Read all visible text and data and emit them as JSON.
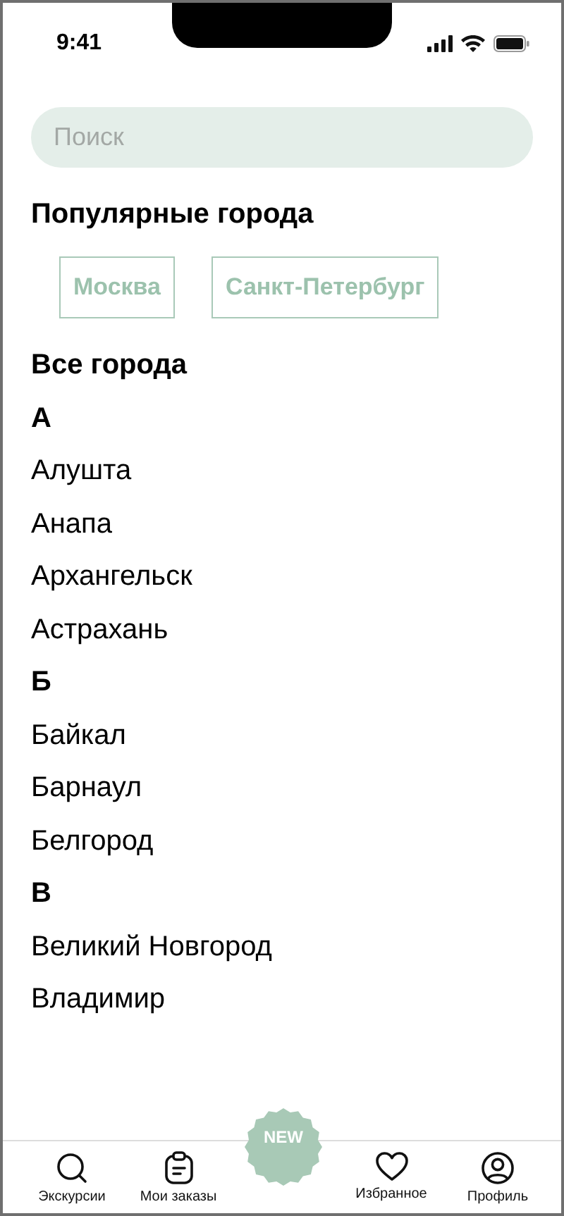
{
  "status_bar": {
    "time": "9:41"
  },
  "search": {
    "placeholder": "Поиск"
  },
  "popular": {
    "title": "Популярные города",
    "cities": [
      "Москва",
      "Санкт-Петербург"
    ]
  },
  "all": {
    "title": "Все города",
    "groups": [
      {
        "letter": "А",
        "cities": [
          "Алушта",
          "Анапа",
          "Архангельск",
          "Астрахань"
        ]
      },
      {
        "letter": "Б",
        "cities": [
          "Байкал",
          "Барнаул",
          "Белгород"
        ]
      },
      {
        "letter": "В",
        "cities": [
          "Великий Новгород",
          "Владимир"
        ]
      }
    ]
  },
  "tab_bar": {
    "items": [
      {
        "label": "Экскурсии"
      },
      {
        "label": "Мои заказы"
      },
      {
        "label": "Избранное"
      },
      {
        "label": "Профиль"
      }
    ],
    "badge": "NEW"
  }
}
